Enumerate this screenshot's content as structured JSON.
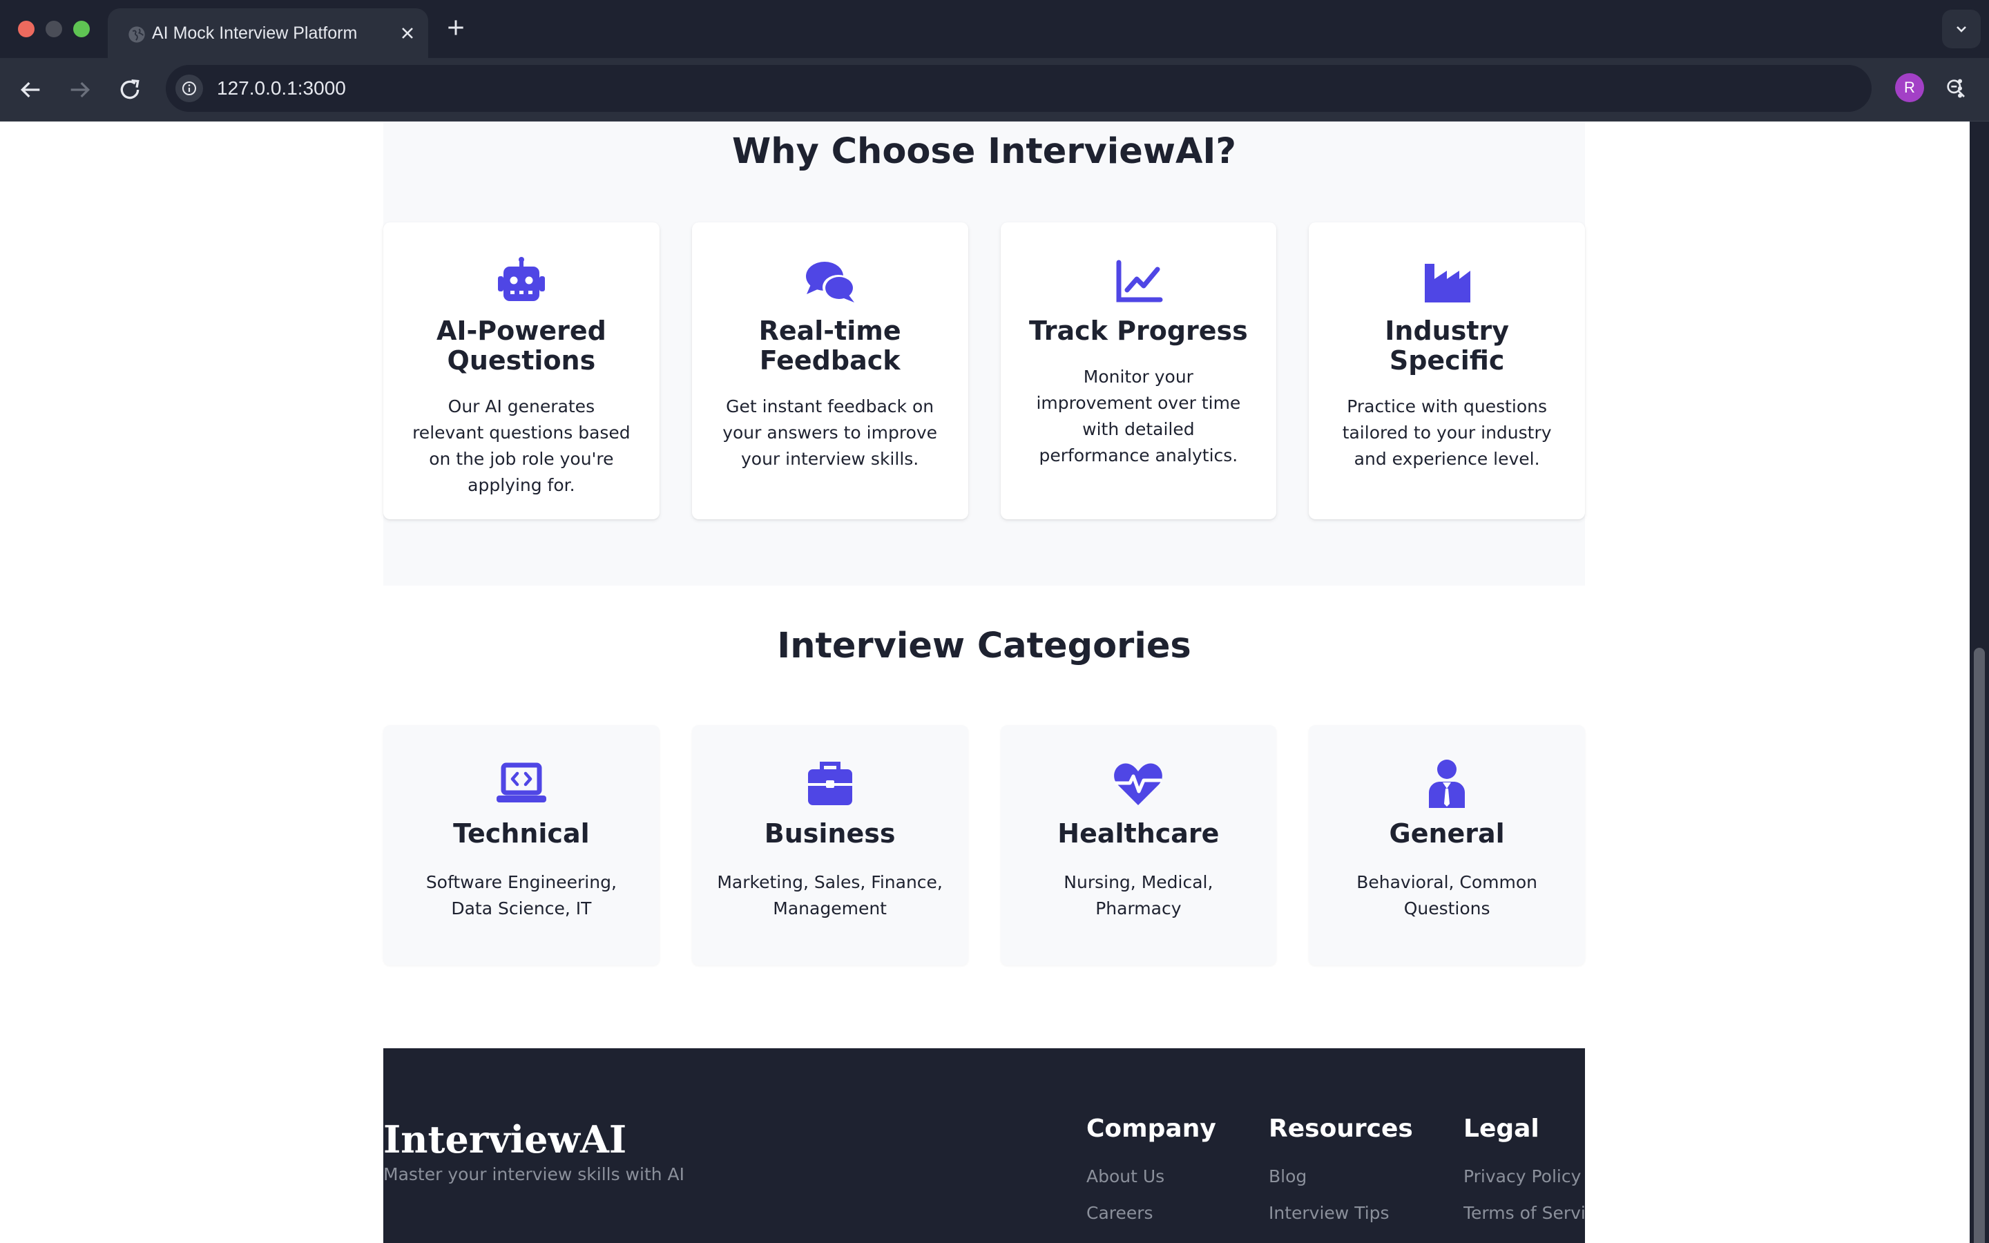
{
  "browser": {
    "tab_title": "AI Mock Interview Platform",
    "url": "127.0.0.1:3000",
    "profile_initial": "R"
  },
  "colors": {
    "accent": "#4f46e5",
    "text": "#1e2230",
    "section_bg": "#f8f9fb",
    "footer_bg": "#1e2230",
    "footer_muted": "#8b909b"
  },
  "why": {
    "title": "Why Choose InterviewAI?",
    "features": [
      {
        "icon": "robot-icon",
        "title": "AI-Powered Questions",
        "desc": "Our AI generates relevant questions based on the job role you're applying for."
      },
      {
        "icon": "chat-bubbles-icon",
        "title": "Real-time Feedback",
        "desc": "Get instant feedback on your answers to improve your interview skills."
      },
      {
        "icon": "line-chart-icon",
        "title": "Track Progress",
        "desc": "Monitor your improvement over time with detailed performance analytics."
      },
      {
        "icon": "industry-icon",
        "title": "Industry Specific",
        "desc": "Practice with questions tailored to your industry and experience level."
      }
    ]
  },
  "categories": {
    "title": "Interview Categories",
    "items": [
      {
        "icon": "laptop-code-icon",
        "title": "Technical",
        "desc": "Software Engineering, Data Science, IT"
      },
      {
        "icon": "briefcase-icon",
        "title": "Business",
        "desc": "Marketing, Sales, Finance, Management"
      },
      {
        "icon": "heart-pulse-icon",
        "title": "Healthcare",
        "desc": "Nursing, Medical, Pharmacy"
      },
      {
        "icon": "user-tie-icon",
        "title": "General",
        "desc": "Behavioral, Common Questions"
      }
    ]
  },
  "footer": {
    "brand": "InterviewAI",
    "tagline": "Master your interview skills with AI",
    "columns": [
      {
        "heading": "Company",
        "links": [
          "About Us",
          "Careers"
        ]
      },
      {
        "heading": "Resources",
        "links": [
          "Blog",
          "Interview Tips"
        ]
      },
      {
        "heading": "Legal",
        "links": [
          "Privacy Policy",
          "Terms of Service"
        ]
      }
    ]
  }
}
